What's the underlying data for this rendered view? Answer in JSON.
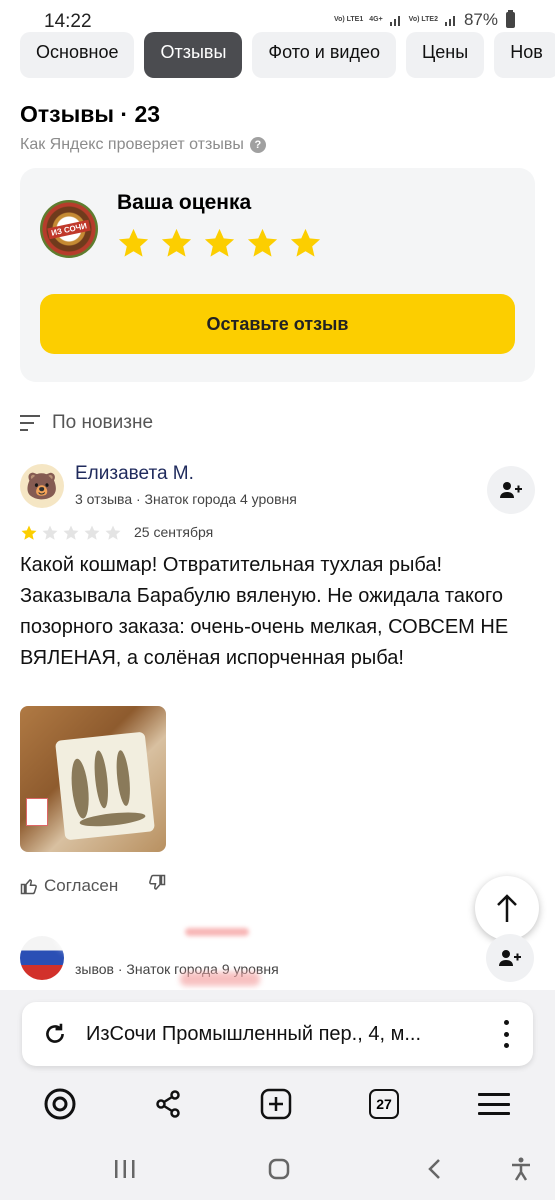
{
  "status_bar": {
    "time": "14:22",
    "sim1": "Vo) LTE1",
    "net_type": "4G+",
    "sim2": "Vo) LTE2",
    "battery": "87%"
  },
  "tabs": [
    {
      "label": "Основное",
      "active": false
    },
    {
      "label": "Отзывы",
      "active": true
    },
    {
      "label": "Фото и видео",
      "active": false
    },
    {
      "label": "Цены",
      "active": false
    },
    {
      "label": "Нов",
      "active": false
    }
  ],
  "reviews_section": {
    "title": "Отзывы · 23",
    "verify_link": "Как Яндекс проверяет отзывы"
  },
  "rate_card": {
    "logo_text": "ИЗ СОЧИ",
    "title": "Ваша оценка",
    "stars": 5,
    "button_label": "Оставьте отзыв",
    "star_color": "#fcce00"
  },
  "sort": {
    "label": "По новизне"
  },
  "review": {
    "author": "Елизавета М.",
    "meta": "3 отзыва · Знаток города 4 уровня",
    "rating": 1,
    "max_rating": 5,
    "date": "25 сентября",
    "text": "Какой кошмар! Отвратительная тухлая рыба! Заказывала Барабулю вяленую. Не ожидала такого позорного заказа: очень-очень мелкая, СОВСЕМ НЕ ВЯЛЕНАЯ, а солёная испорченная рыба!",
    "agree_label": "Согласен"
  },
  "review2": {
    "meta": "зывов · Знаток города 9 уровня"
  },
  "browser": {
    "address": "ИзСочи Промышленный пер., 4, м...",
    "tabs_count": "27"
  }
}
